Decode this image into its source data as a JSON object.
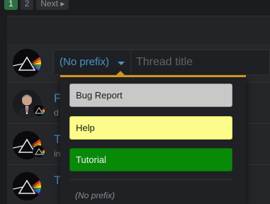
{
  "pagination": {
    "current": "1",
    "next_page": "2",
    "next_label": "Next"
  },
  "composer": {
    "prefix_label": "(No prefix)",
    "title_placeholder": "Thread title"
  },
  "threads": [
    {
      "title": "F",
      "subtitle": "d"
    },
    {
      "title": "T",
      "subtitle": "in"
    },
    {
      "title": "T",
      "subtitle": ""
    }
  ],
  "prefix_menu": {
    "options": [
      "Bug Report",
      "Help",
      "Tutorial"
    ],
    "none_option": "(No prefix)"
  },
  "colors": {
    "accent": "#d49320",
    "link": "#4b93cf",
    "bug_report": "#c8c8c8",
    "help": "#fcfc8b",
    "tutorial": "#088a08",
    "pager_active": "#2f6e44"
  }
}
